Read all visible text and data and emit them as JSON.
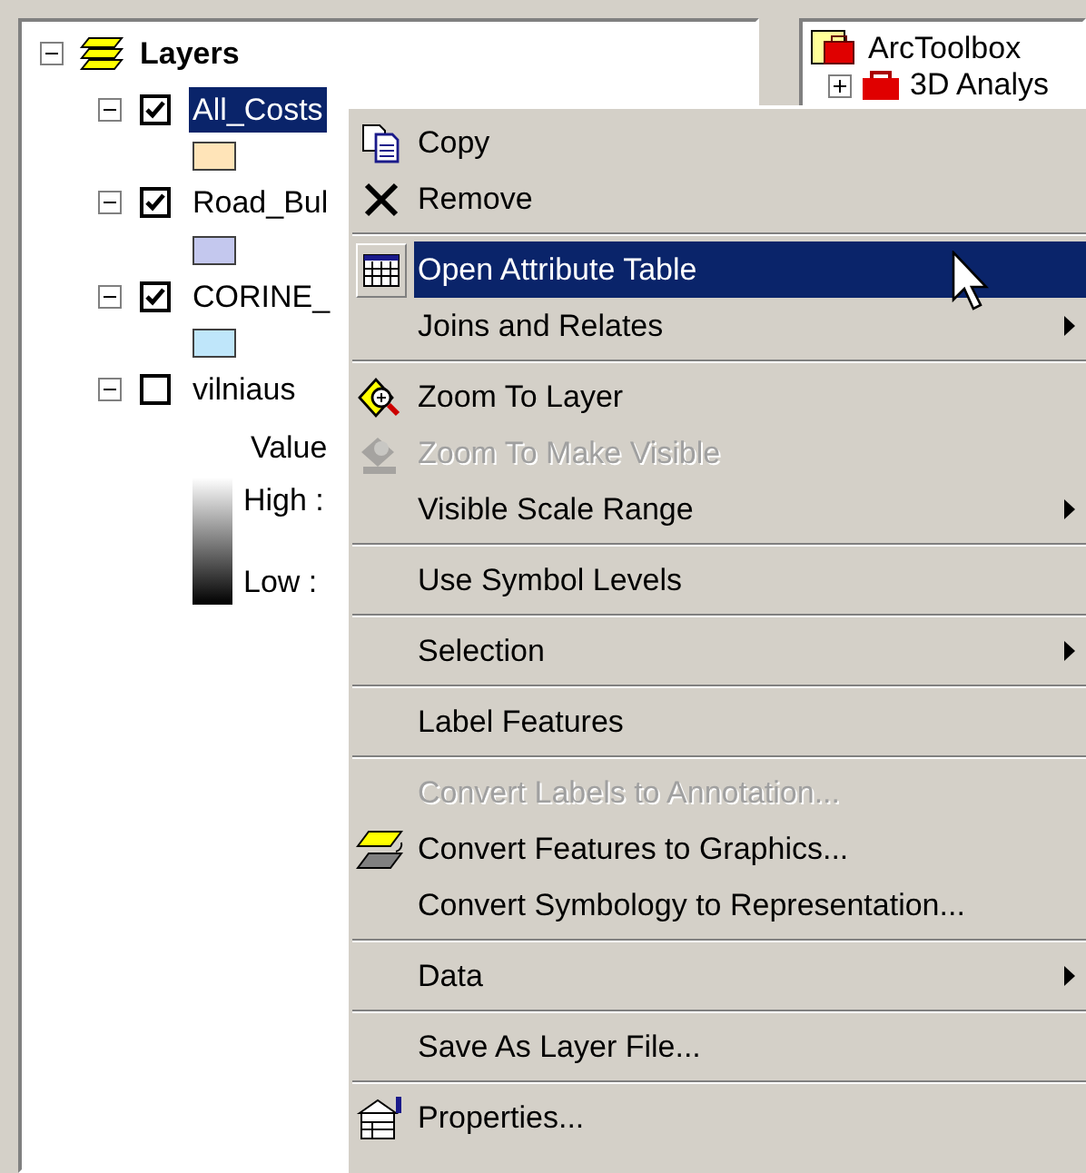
{
  "toc": {
    "title": "Layers",
    "expanded": true,
    "layers": [
      {
        "name": "All_Costs",
        "checked": true,
        "selected": true,
        "expanded": true,
        "color": "#ffe4b8"
      },
      {
        "name": "Road_Bul",
        "checked": true,
        "selected": false,
        "expanded": true,
        "color": "#c4c8ee"
      },
      {
        "name": "CORINE_",
        "checked": true,
        "selected": false,
        "expanded": true,
        "color": "#bfe6fa"
      },
      {
        "name": "vilniaus",
        "checked": false,
        "selected": false,
        "expanded": true,
        "legend": {
          "heading": "Value",
          "high": "High :",
          "low": "Low :"
        }
      }
    ]
  },
  "toolbox": {
    "title": "ArcToolbox",
    "items": [
      {
        "label": "3D Analys"
      }
    ]
  },
  "context_menu": {
    "items": [
      {
        "kind": "item",
        "label": "Copy",
        "disabled": false,
        "selected": false,
        "submenu": false
      },
      {
        "kind": "item",
        "label": "Remove",
        "disabled": false,
        "selected": false,
        "submenu": false
      },
      {
        "kind": "separator"
      },
      {
        "kind": "item",
        "label": "Open Attribute Table",
        "disabled": false,
        "selected": true,
        "submenu": false
      },
      {
        "kind": "item",
        "label": "Joins and Relates",
        "disabled": false,
        "selected": false,
        "submenu": true
      },
      {
        "kind": "separator"
      },
      {
        "kind": "item",
        "label": "Zoom To Layer",
        "disabled": false,
        "selected": false,
        "submenu": false
      },
      {
        "kind": "item",
        "label": "Zoom To Make Visible",
        "disabled": true,
        "selected": false,
        "submenu": false
      },
      {
        "kind": "item",
        "label": "Visible Scale Range",
        "disabled": false,
        "selected": false,
        "submenu": true
      },
      {
        "kind": "separator"
      },
      {
        "kind": "item",
        "label": "Use Symbol Levels",
        "disabled": false,
        "selected": false,
        "submenu": false
      },
      {
        "kind": "separator"
      },
      {
        "kind": "item",
        "label": "Selection",
        "disabled": false,
        "selected": false,
        "submenu": true
      },
      {
        "kind": "separator"
      },
      {
        "kind": "item",
        "label": "Label Features",
        "disabled": false,
        "selected": false,
        "submenu": false
      },
      {
        "kind": "separator"
      },
      {
        "kind": "item",
        "label": "Convert Labels to Annotation...",
        "disabled": true,
        "selected": false,
        "submenu": false
      },
      {
        "kind": "item",
        "label": "Convert Features to Graphics...",
        "disabled": false,
        "selected": false,
        "submenu": false
      },
      {
        "kind": "item",
        "label": "Convert Symbology to Representation...",
        "disabled": false,
        "selected": false,
        "submenu": false
      },
      {
        "kind": "separator"
      },
      {
        "kind": "item",
        "label": "Data",
        "disabled": false,
        "selected": false,
        "submenu": true
      },
      {
        "kind": "separator"
      },
      {
        "kind": "item",
        "label": "Save As Layer File...",
        "disabled": false,
        "selected": false,
        "submenu": false
      },
      {
        "kind": "separator"
      },
      {
        "kind": "item",
        "label": "Properties...",
        "disabled": false,
        "selected": false,
        "submenu": false
      }
    ]
  }
}
